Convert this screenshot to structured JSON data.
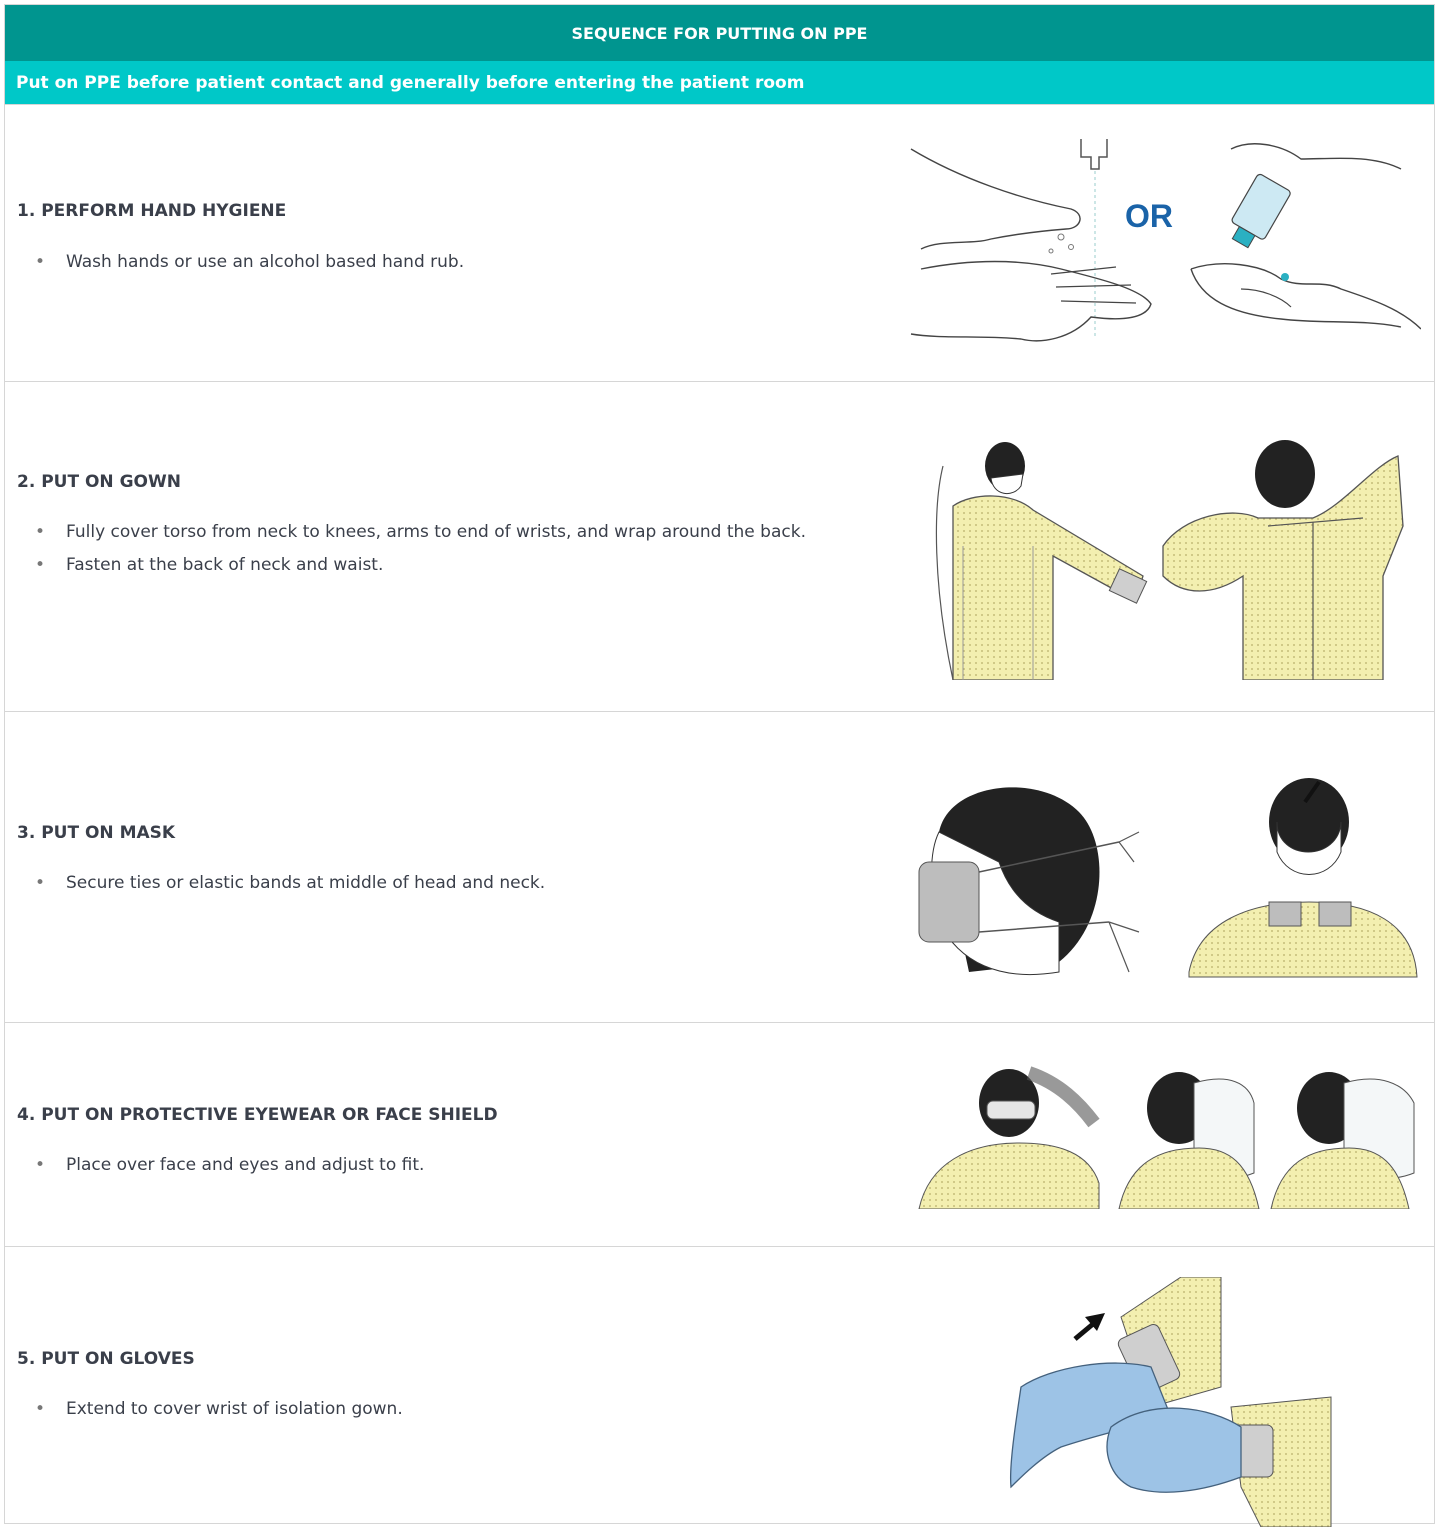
{
  "header": {
    "title": "SEQUENCE FOR PUTTING ON PPE",
    "subtitle": "Put on PPE before patient contact and generally before entering the patient room"
  },
  "steps": [
    {
      "heading": "1. PERFORM HAND HYGIENE",
      "bullets": [
        "Wash hands or use an alcohol based hand rub."
      ],
      "illustration_text": "OR"
    },
    {
      "heading": "2. PUT ON GOWN",
      "bullets": [
        "Fully cover torso from neck to knees, arms to end of wrists, and wrap around the back.",
        "Fasten at the back of neck and waist."
      ]
    },
    {
      "heading": "3. PUT ON MASK",
      "bullets": [
        "Secure ties or elastic bands at middle of head and neck."
      ]
    },
    {
      "heading": "4. PUT ON PROTECTIVE EYEWEAR OR FACE SHIELD",
      "bullets": [
        "Place over face and eyes and adjust to fit."
      ]
    },
    {
      "heading": "5. PUT ON GLOVES",
      "bullets": [
        "Extend to cover wrist of isolation gown."
      ]
    }
  ],
  "colors": {
    "title_bg": "#00958f",
    "subtitle_bg": "#00c8c8",
    "gown_yellow": "#f3efb0",
    "glove_blue": "#9dc3e6",
    "or_blue": "#1a63a8"
  }
}
